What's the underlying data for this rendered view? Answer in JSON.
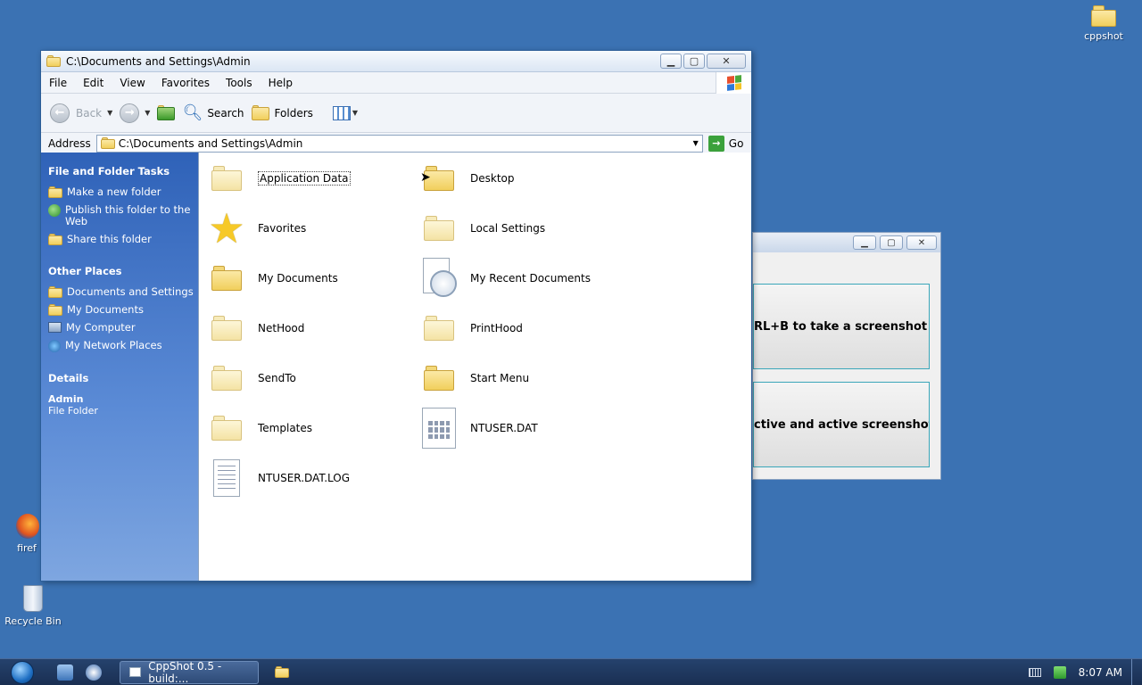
{
  "desktop": {
    "icons": [
      {
        "label": "cppshot",
        "icon": "folder-icon"
      },
      {
        "label": "firef",
        "icon": "firefox-icon"
      },
      {
        "label": "Recycle Bin",
        "icon": "recycle-bin-icon"
      }
    ]
  },
  "explorer": {
    "title": "C:\\Documents and Settings\\Admin",
    "menu": [
      "File",
      "Edit",
      "View",
      "Favorites",
      "Tools",
      "Help"
    ],
    "toolbar": {
      "back_label": "Back",
      "search_label": "Search",
      "folders_label": "Folders"
    },
    "address": {
      "label": "Address",
      "value": "C:\\Documents and Settings\\Admin",
      "go_label": "Go"
    },
    "taskpane": {
      "file_tasks": {
        "heading": "File and Folder Tasks",
        "items": [
          "Make a new folder",
          "Publish this folder to the Web",
          "Share this folder"
        ]
      },
      "other_places": {
        "heading": "Other Places",
        "items": [
          "Documents and Settings",
          "My Documents",
          "My Computer",
          "My Network Places"
        ]
      },
      "details": {
        "heading": "Details",
        "name": "Admin",
        "type": "File Folder"
      }
    },
    "files": [
      {
        "name": "Application Data",
        "icon": "folder-pale"
      },
      {
        "name": "Desktop",
        "icon": "folder"
      },
      {
        "name": "Favorites",
        "icon": "star"
      },
      {
        "name": "Local Settings",
        "icon": "folder-pale"
      },
      {
        "name": "My Documents",
        "icon": "folder"
      },
      {
        "name": "My Recent Documents",
        "icon": "recent-docs"
      },
      {
        "name": "NetHood",
        "icon": "folder-pale"
      },
      {
        "name": "PrintHood",
        "icon": "folder-pale"
      },
      {
        "name": "SendTo",
        "icon": "folder-pale"
      },
      {
        "name": "Start Menu",
        "icon": "folder"
      },
      {
        "name": "Templates",
        "icon": "folder-pale"
      },
      {
        "name": "NTUSER.DAT",
        "icon": "dat-file"
      },
      {
        "name": "NTUSER.DAT.LOG",
        "icon": "log-file"
      }
    ]
  },
  "cppshot_window": {
    "button1_text": "RL+B to take a screenshot",
    "button2_text": "ctive and active screenshots"
  },
  "taskbar": {
    "task_label": "CppShot 0.5 - build:...",
    "clock": "8:07 AM"
  },
  "colors": {
    "desktop": "#3b72b3",
    "taskpane_top": "#2f62b8",
    "taskbar": "#1a2f52"
  }
}
